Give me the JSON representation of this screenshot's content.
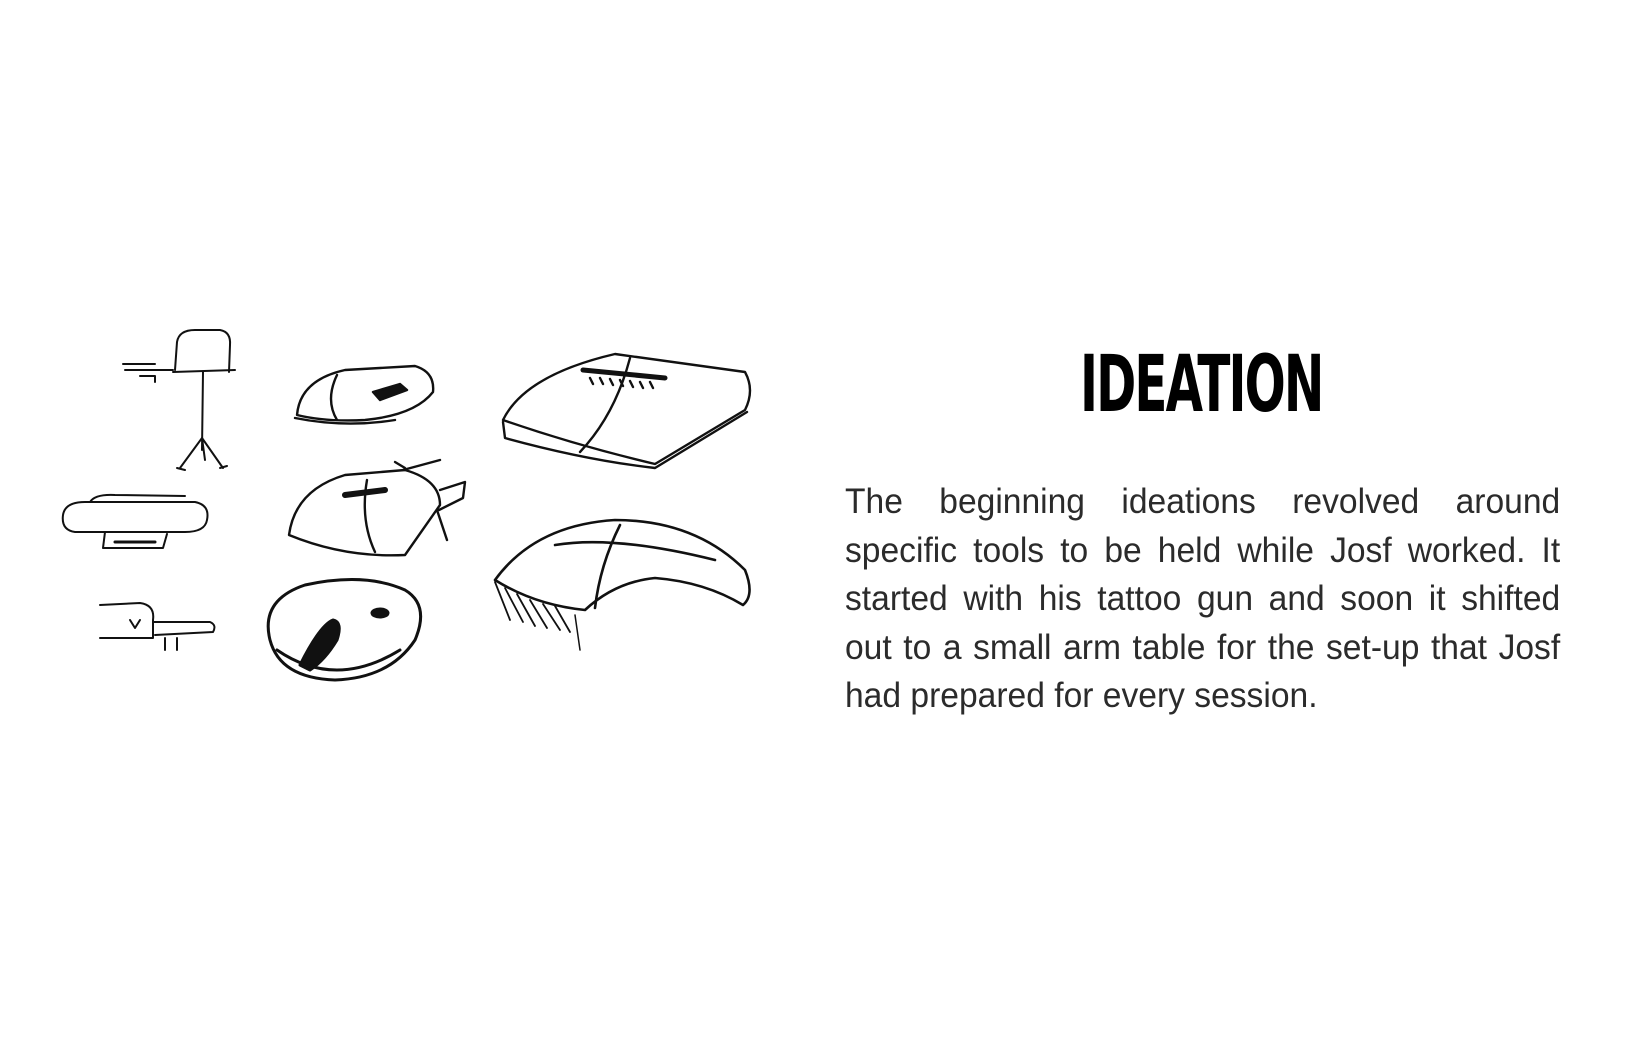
{
  "page": {
    "title": "IDEATION",
    "body": "The beginning ideations revolved around specific tools to be held while Josf worked. It started with his tattoo gun and soon it shifted out to a small arm table for the set-up that Josf had prepared for every session."
  },
  "colors": {
    "background": "#ffffff",
    "ink": "#000000",
    "text": "#2b2b2b"
  }
}
